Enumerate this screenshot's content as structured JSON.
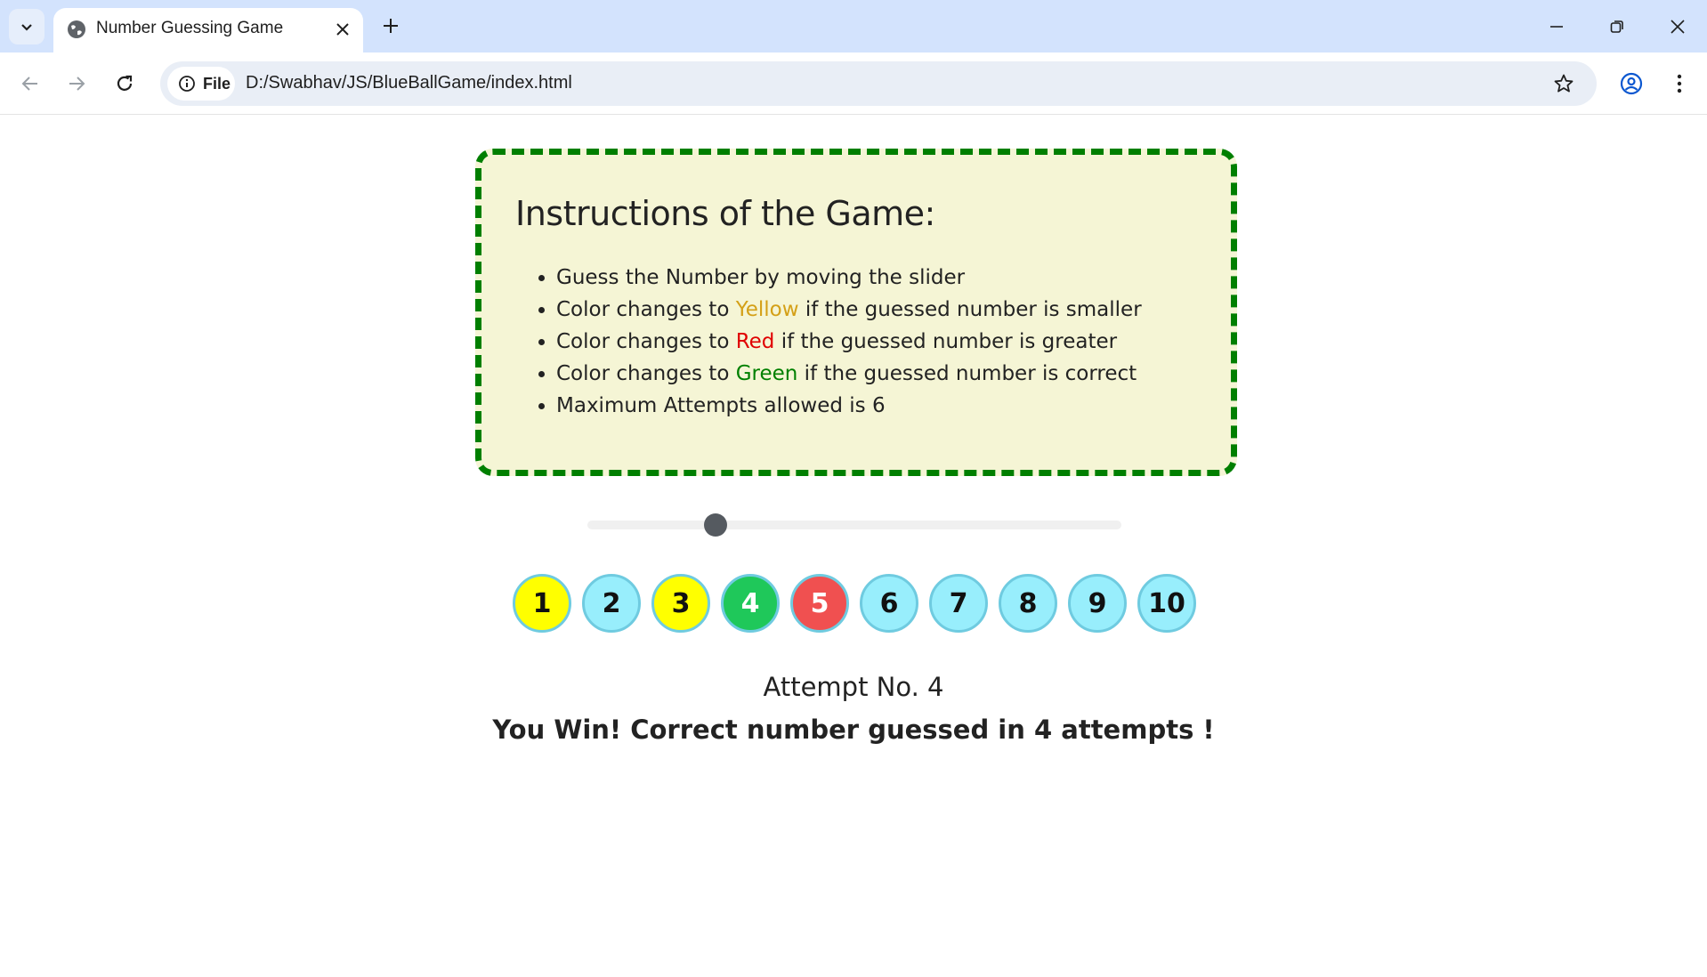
{
  "browser": {
    "tab_title": "Number Guessing Game",
    "chip_label": "File",
    "url": "D:/Swabhav/JS/BlueBallGame/index.html",
    "icons": [
      "tab-search-icon",
      "globe-icon",
      "close-icon",
      "plus-icon",
      "minimize-icon",
      "restore-icon",
      "window-close-icon",
      "back-icon",
      "forward-icon",
      "reload-icon",
      "info-icon",
      "star-icon",
      "profile-icon",
      "menu-icon"
    ]
  },
  "instructions": {
    "title": "Instructions of the Game:",
    "item1": "Guess the Number by moving the slider",
    "item2_pre": "Color changes to ",
    "item2_color": "Yellow",
    "item2_post": " if the guessed number is smaller",
    "item3_pre": "Color changes to ",
    "item3_color": "Red",
    "item3_post": " if the guessed number is greater",
    "item4_pre": "Color changes to ",
    "item4_color": "Green",
    "item4_post": " if the guessed number is correct",
    "item5": "Maximum Attempts allowed is 6"
  },
  "slider": {
    "min": 1,
    "max": 10,
    "value": 4
  },
  "balls": [
    {
      "label": "1",
      "state": "yellow"
    },
    {
      "label": "2",
      "state": "blue"
    },
    {
      "label": "3",
      "state": "yellow"
    },
    {
      "label": "4",
      "state": "green"
    },
    {
      "label": "5",
      "state": "red"
    },
    {
      "label": "6",
      "state": "blue"
    },
    {
      "label": "7",
      "state": "blue"
    },
    {
      "label": "8",
      "state": "blue"
    },
    {
      "label": "9",
      "state": "blue"
    },
    {
      "label": "10",
      "state": "blue"
    }
  ],
  "status": {
    "attempt": "Attempt No. 4",
    "result": "You Win! Correct number guessed in 4 attempts !"
  },
  "colors": {
    "ball_default": "#98eefc",
    "smaller": "#ffff00",
    "correct": "#1fc85a",
    "greater": "#f05050",
    "border": "#007f00",
    "panel": "#f5f5d5"
  }
}
